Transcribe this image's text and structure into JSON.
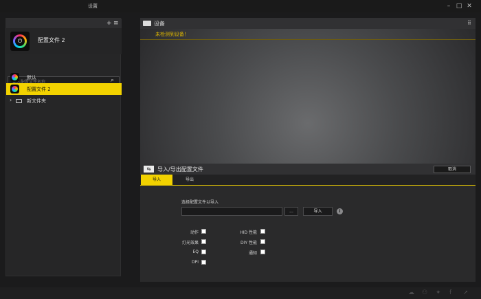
{
  "window": {
    "title": "设置",
    "minimize": "–",
    "maximize": "□",
    "close": "✕"
  },
  "sidebar": {
    "add_icon": "+",
    "menu_icon": "≡",
    "current_profile": "配置文件 2",
    "search_placeholder": "输入配置文件名称",
    "items": [
      {
        "label": "默认"
      },
      {
        "label": "配置文件 2"
      },
      {
        "label": "新文件夹"
      }
    ]
  },
  "device": {
    "header": "设备",
    "warning": "未检测到设备！"
  },
  "import_export": {
    "title": "导入/导出配置文件",
    "cancel_label": "取消",
    "tabs": [
      {
        "label": "导入"
      },
      {
        "label": "导出"
      }
    ],
    "select_label": "选择配置文件以导入",
    "browse_label": "...",
    "import_label": "导入",
    "info_icon": "i",
    "options_left": [
      {
        "label": "动作",
        "checked": true
      },
      {
        "label": "灯光效果",
        "checked": true
      },
      {
        "label": "EQ",
        "checked": true
      },
      {
        "label": "DPI",
        "checked": true
      }
    ],
    "options_right": [
      {
        "label": "HID 性能",
        "checked": true
      },
      {
        "label": "DIY 性能",
        "checked": true
      },
      {
        "label": "通知",
        "checked": true
      }
    ]
  },
  "colors": {
    "accent": "#f2d200",
    "warning_text": "#e0b800"
  }
}
